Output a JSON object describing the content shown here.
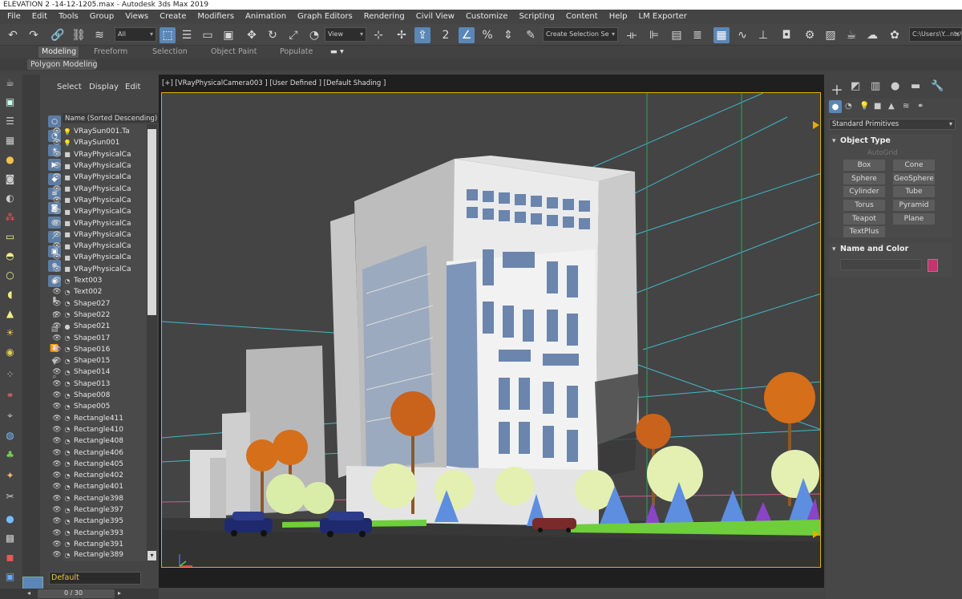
{
  "window": {
    "title": "ELEVATION 2 -14-12-1205.max - Autodesk 3ds Max 2019"
  },
  "menu": [
    "File",
    "Edit",
    "Tools",
    "Group",
    "Views",
    "Create",
    "Modifiers",
    "Animation",
    "Graph Editors",
    "Rendering",
    "Civil View",
    "Customize",
    "Scripting",
    "Content",
    "Help",
    "LM Exporter"
  ],
  "toolbar": {
    "selection_filter": "All",
    "ref_coord": "View",
    "named_selection": "Create Selection Se",
    "path": "C:\\Users\\Y...nts\\"
  },
  "ribbon": {
    "tabs": [
      "Modeling",
      "Freeform",
      "Selection",
      "Object Paint",
      "Populate"
    ],
    "active_tab": "Modeling",
    "sub_label": "Polygon Modeling"
  },
  "explorer": {
    "tabs": [
      "Select",
      "Display",
      "Edit"
    ],
    "header": "Name (Sorted Descending)",
    "items": [
      "VRaySun001.Ta",
      "VRaySun001",
      "VRayPhysicalCa",
      "VRayPhysicalCa",
      "VRayPhysicalCa",
      "VRayPhysicalCa",
      "VRayPhysicalCa",
      "VRayPhysicalCa",
      "VRayPhysicalCa",
      "VRayPhysicalCa",
      "VRayPhysicalCa",
      "VRayPhysicalCa",
      "VRayPhysicalCa",
      "Text003",
      "Text002",
      "Shape027",
      "Shape022",
      "Shape021",
      "Shape017",
      "Shape016",
      "Shape015",
      "Shape014",
      "Shape013",
      "Shape008",
      "Shape005",
      "Rectangle411",
      "Rectangle410",
      "Rectangle408",
      "Rectangle406",
      "Rectangle405",
      "Rectangle402",
      "Rectangle401",
      "Rectangle398",
      "Rectangle397",
      "Rectangle395",
      "Rectangle393",
      "Rectangle391",
      "Rectangle389"
    ],
    "layer": "Default",
    "frame": "0 / 30"
  },
  "viewport": {
    "label": "[+] [VRayPhysicalCamera003 ] [User Defined ] [Default Shading ]"
  },
  "command_panel": {
    "dropdown": "Standard Primitives",
    "object_type_title": "Object Type",
    "autogrid": "AutoGrid",
    "buttons": [
      "Box",
      "Cone",
      "Sphere",
      "GeoSphere",
      "Cylinder",
      "Tube",
      "Torus",
      "Pyramid",
      "Teapot",
      "Plane",
      "TextPlus"
    ],
    "name_color_title": "Name and Color",
    "color": "#c7336f"
  }
}
